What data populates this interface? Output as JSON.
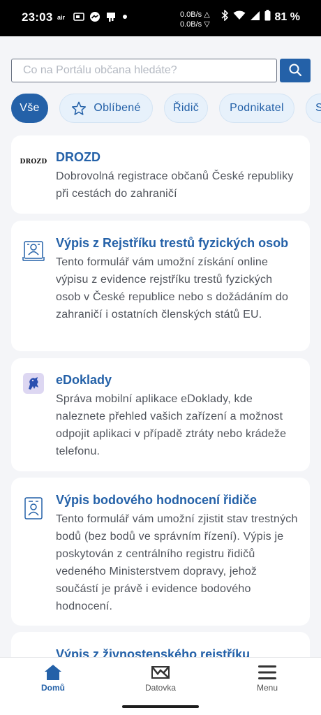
{
  "status_bar": {
    "time": "23:03",
    "net_up": "0.0B/s △",
    "net_down": "0.0B/s ▽",
    "battery": "81 %",
    "left_icons": [
      "air-icon",
      "cast-icon",
      "messenger-icon",
      "notification-icon",
      "dot-icon"
    ],
    "right_icons": [
      "bluetooth-icon",
      "wifi-icon",
      "signal-icon",
      "battery-icon"
    ]
  },
  "search": {
    "placeholder": "Co na Portálu občana hledáte?",
    "value": "",
    "button_icon": "search-icon"
  },
  "filters": [
    {
      "label": "Vše",
      "active": true
    },
    {
      "label": "Oblíbené",
      "icon": "star-icon",
      "active": false
    },
    {
      "label": "Řidič",
      "active": false
    },
    {
      "label": "Podnikatel",
      "active": false
    },
    {
      "label": "S",
      "active": false
    }
  ],
  "cards": [
    {
      "icon": "drozd-logo",
      "logo_text": "DROZD",
      "title": "DROZD",
      "description": "Dobrovolná registrace občanů České republiky při cestách do zahraničí"
    },
    {
      "icon": "criminal-record-icon",
      "title": "Výpis z Rejstříku trestů fyzických osob",
      "description": "Tento formulář vám umožní získání online výpisu z evidence rejstříku trestů fyzických osob v České republice nebo s dožádáním do zahraničí i ostatních členských států EU."
    },
    {
      "icon": "edoklady-lion-icon",
      "title": "eDoklady",
      "description": "Správa mobilní aplikace eDoklady, kde naleznete přehled vašich zařízení a možnost odpojit aplikaci v případě ztráty nebo krádeže telefonu."
    },
    {
      "icon": "driver-points-icon",
      "title": "Výpis bodového hodnocení řidiče",
      "description": "Tento formulář vám umožní zjistit stav trestných bodů (bez bodů ve správním řízení). Výpis je poskytován z centrálního registru řidičů vedeného Ministerstvem dopravy, jehož součástí je právě i evidence bodového hodnocení."
    },
    {
      "icon": "trade-register-icon",
      "title": "Výpis z živnostenského rejstříku",
      "description": ""
    }
  ],
  "bottom_nav": [
    {
      "label": "Domů",
      "icon": "home-icon",
      "active": true
    },
    {
      "label": "Datovka",
      "icon": "databox-icon",
      "active": false
    },
    {
      "label": "Menu",
      "icon": "menu-icon",
      "active": false
    }
  ],
  "colors": {
    "primary": "#2461a8",
    "chip_bg": "#e7f1fb",
    "page_bg": "#f4f5f8"
  }
}
